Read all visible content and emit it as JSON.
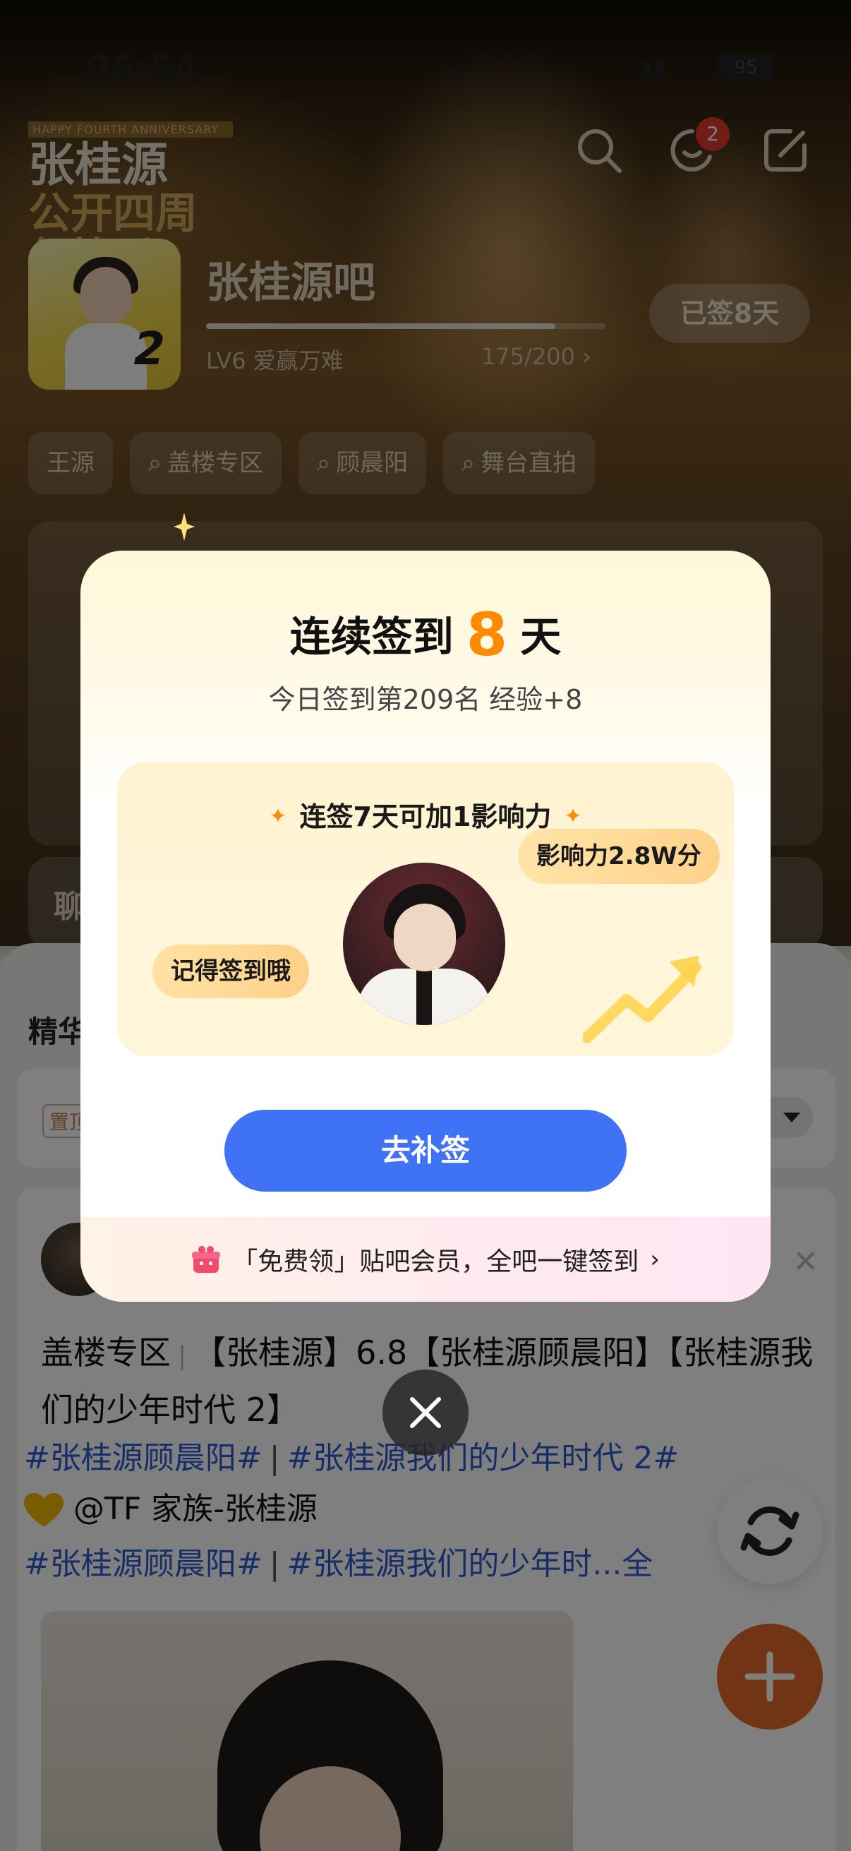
{
  "status_bar": {
    "time": "06:54",
    "battery": "95"
  },
  "banner": {
    "anniversary_small": "HAPPY FOURTH ANNIVERSARY",
    "anniversary_line1": "张桂源",
    "anniversary_line2": "公开四周年快乐",
    "notification_count": "2"
  },
  "forum": {
    "name": "张桂源吧",
    "level": "LV6 爱赢万难",
    "exp": "175/200 ›",
    "exp_progress": 0.875,
    "signed_label": "已签8天",
    "avatar_number": "2"
  },
  "tags": [
    "王源",
    "盖楼专区",
    "顾晨阳",
    "舞台直拍"
  ],
  "background_card": {
    "title": "聊"
  },
  "feed": {
    "section_label": "精华",
    "pinned_label": "置顶"
  },
  "post": {
    "zone": "盖楼专区",
    "title": "【张桂源】6.8【张桂源顾晨阳】【张桂源我们的少年时代 2】",
    "hashtags_line1_a": "#张桂源顾晨阳#",
    "hashtags_line1_b": "#张桂源我们的少年时代 2#",
    "mention": "@TF 家族-张桂源",
    "hashtags_line2_a": "#张桂源顾晨阳#",
    "hashtags_line2_b": "#张桂源我们的少年时...全"
  },
  "modal": {
    "title_prefix": "连续签到",
    "streak_days": "8",
    "title_suffix": "天",
    "subtitle": "今日签到第209名 经验+8",
    "promo_heading": "连签7天可加1影响力",
    "reminder_bubble": "记得签到哦",
    "influence_bubble": "影响力2.8W分",
    "cta_label": "去补签",
    "vip_text": "「免费领」贴吧会员，全吧一键签到",
    "vip_chevron": "›"
  },
  "colors": {
    "accent_orange": "#ff8a00",
    "cta_blue": "#3f72f5",
    "hashtag_blue": "#2f5bd0",
    "badge_red": "#e03a2e"
  }
}
